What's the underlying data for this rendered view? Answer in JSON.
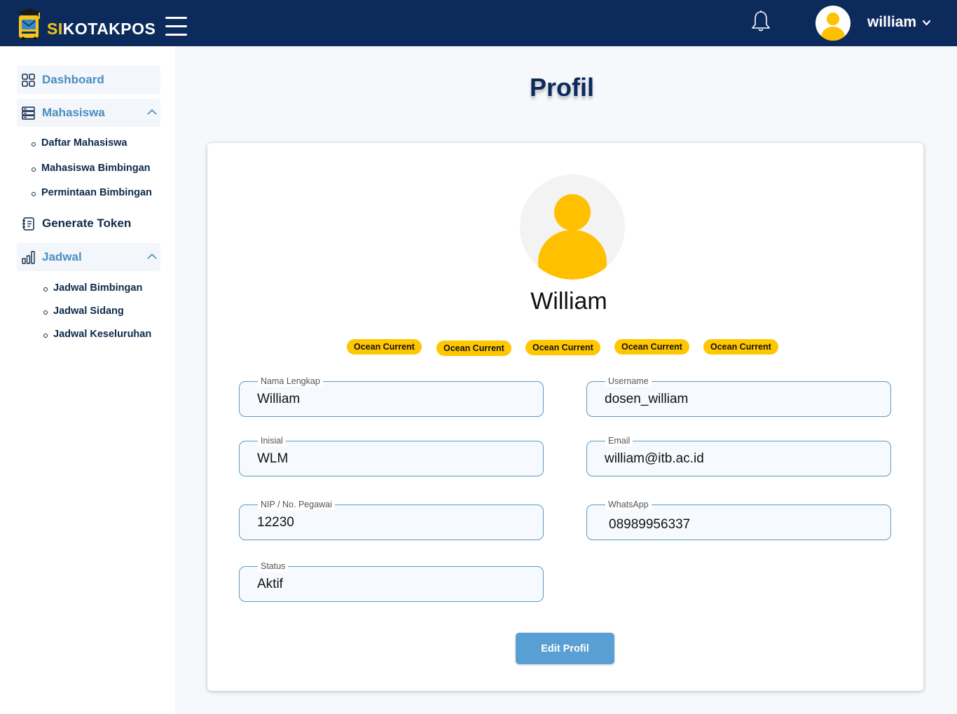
{
  "header": {
    "brand_prefix": "SI",
    "brand_rest": "KOTAKPOS",
    "username": "william"
  },
  "sidebar": {
    "dashboard": "Dashboard",
    "mahasiswa": "Mahasiswa",
    "mahasiswa_items": [
      "Daftar Mahasiswa",
      "Mahasiswa Bimbingan",
      "Permintaan Bimbingan"
    ],
    "generate_token": "Generate Token",
    "jadwal": "Jadwal",
    "jadwal_items": [
      "Jadwal Bimbingan",
      "Jadwal Sidang",
      "Jadwal Keseluruhan"
    ]
  },
  "main": {
    "title": "Profil",
    "profile_name": "William",
    "badges": [
      "Ocean Current",
      "Ocean Current",
      "Ocean Current",
      "Ocean Current",
      "Ocean Current"
    ],
    "fields": {
      "nama_lengkap": {
        "label": "Nama Lengkap",
        "value": "William"
      },
      "username": {
        "label": "Username",
        "value": "dosen_william"
      },
      "inisial": {
        "label": "Inisial",
        "value": "WLM"
      },
      "email": {
        "label": "Email",
        "value": "william@itb.ac.id"
      },
      "nip": {
        "label": "NIP / No. Pegawai",
        "value": "12230"
      },
      "whatsapp": {
        "label": "WhatsApp",
        "value": "08989956337"
      },
      "status": {
        "label": "Status",
        "value": "Aktif"
      }
    },
    "edit_button": "Edit Profil"
  },
  "colors": {
    "topbar": "#0c2a5b",
    "accent_yellow": "#ffc700",
    "accent_blue": "#5a9fd4",
    "sidebar_active_text": "#4a8fc1"
  },
  "icons": {
    "logo": "graduation-mailbox-logo",
    "menu": "hamburger-icon",
    "notifications": "bell-icon",
    "user": "user-avatar-icon",
    "dashboard": "grid-icon",
    "mahasiswa": "database-icon",
    "generate_token": "notebook-icon",
    "jadwal": "bar-chart-icon"
  }
}
